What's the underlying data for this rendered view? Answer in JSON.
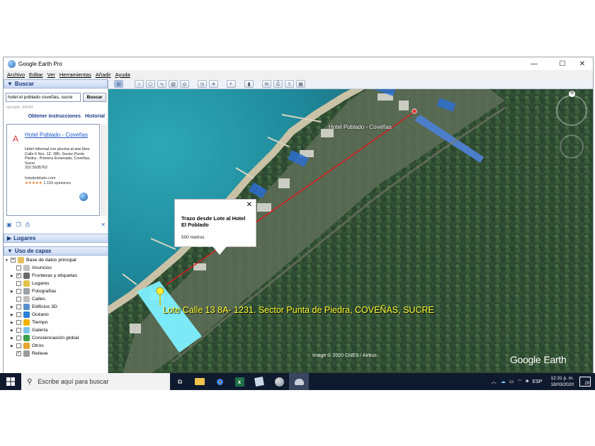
{
  "window": {
    "title": "Google Earth Pro"
  },
  "menu": [
    "Archivo",
    "Editar",
    "Ver",
    "Herramientas",
    "Añadir",
    "Ayuda"
  ],
  "search_panel": {
    "header": "Buscar",
    "query": "hotel el poblado coveñas, sucre",
    "button": "Buscar",
    "hint": "ejemplo: 94043",
    "links": [
      "Obtener instrucciones",
      "Historial"
    ],
    "result": {
      "marker": "A",
      "name": "Hotel Poblado - Coveñas",
      "description": "Hotel informal con piscina al aire libre",
      "address": "Calle 6 Nro. 12- 386, Sector Punte Piedra - Primera Ensenada, Coveñas, Sucre",
      "phone": "310 5935762",
      "website": "hotelpoblado.com",
      "rating_stars": "★★★★★",
      "rating_text": "1.103 opiniones"
    }
  },
  "places_panel": {
    "header": "Lugares"
  },
  "layers_panel": {
    "header": "Uso de capas",
    "root": "Base de datos principal",
    "items": [
      {
        "label": "Anuncios",
        "checked": false,
        "expandable": false
      },
      {
        "label": "Fronteras y etiquetas",
        "checked": true,
        "expandable": true
      },
      {
        "label": "Lugares",
        "checked": false,
        "expandable": false
      },
      {
        "label": "Fotografías",
        "checked": false,
        "expandable": true
      },
      {
        "label": "Calles",
        "checked": false,
        "expandable": false
      },
      {
        "label": "Edificios 3D",
        "checked": false,
        "expandable": true
      },
      {
        "label": "Océano",
        "checked": false,
        "expandable": true
      },
      {
        "label": "Tiempo",
        "checked": false,
        "expandable": true
      },
      {
        "label": "Galería",
        "checked": false,
        "expandable": true
      },
      {
        "label": "Concienciación global",
        "checked": false,
        "expandable": true
      },
      {
        "label": "Otros",
        "checked": false,
        "expandable": true
      },
      {
        "label": "Relieve",
        "checked": true,
        "expandable": false
      }
    ]
  },
  "map": {
    "hotel_label": "Hotel Poblado - Coveñas",
    "lote_label": "Lote Calle 13 8A- 1231. Sector Punta de Piedra, COVEÑAS, SUCRE",
    "copyright": "Image © 2020 CNES / Airbus",
    "logo_main": "Google",
    "logo_sub": "Earth",
    "compass_letter": "N",
    "balloon": {
      "title": "Trazo desde Lote al Hotel El Poblado",
      "distance": "500 metros",
      "close": "✕"
    }
  },
  "taskbar": {
    "search_placeholder": "Escribe aquí para buscar",
    "language": "ESP",
    "time": "12:31 p. m.",
    "date": "18/03/2020",
    "notifications": "29"
  },
  "colors": {
    "title_accent": "#1a3a7a",
    "link": "#1a55c9",
    "lote_label": "#ffff33",
    "path_line": "#d42020",
    "lot_polygon": "#7ff0ff",
    "taskbar": "#0f1a2e"
  }
}
